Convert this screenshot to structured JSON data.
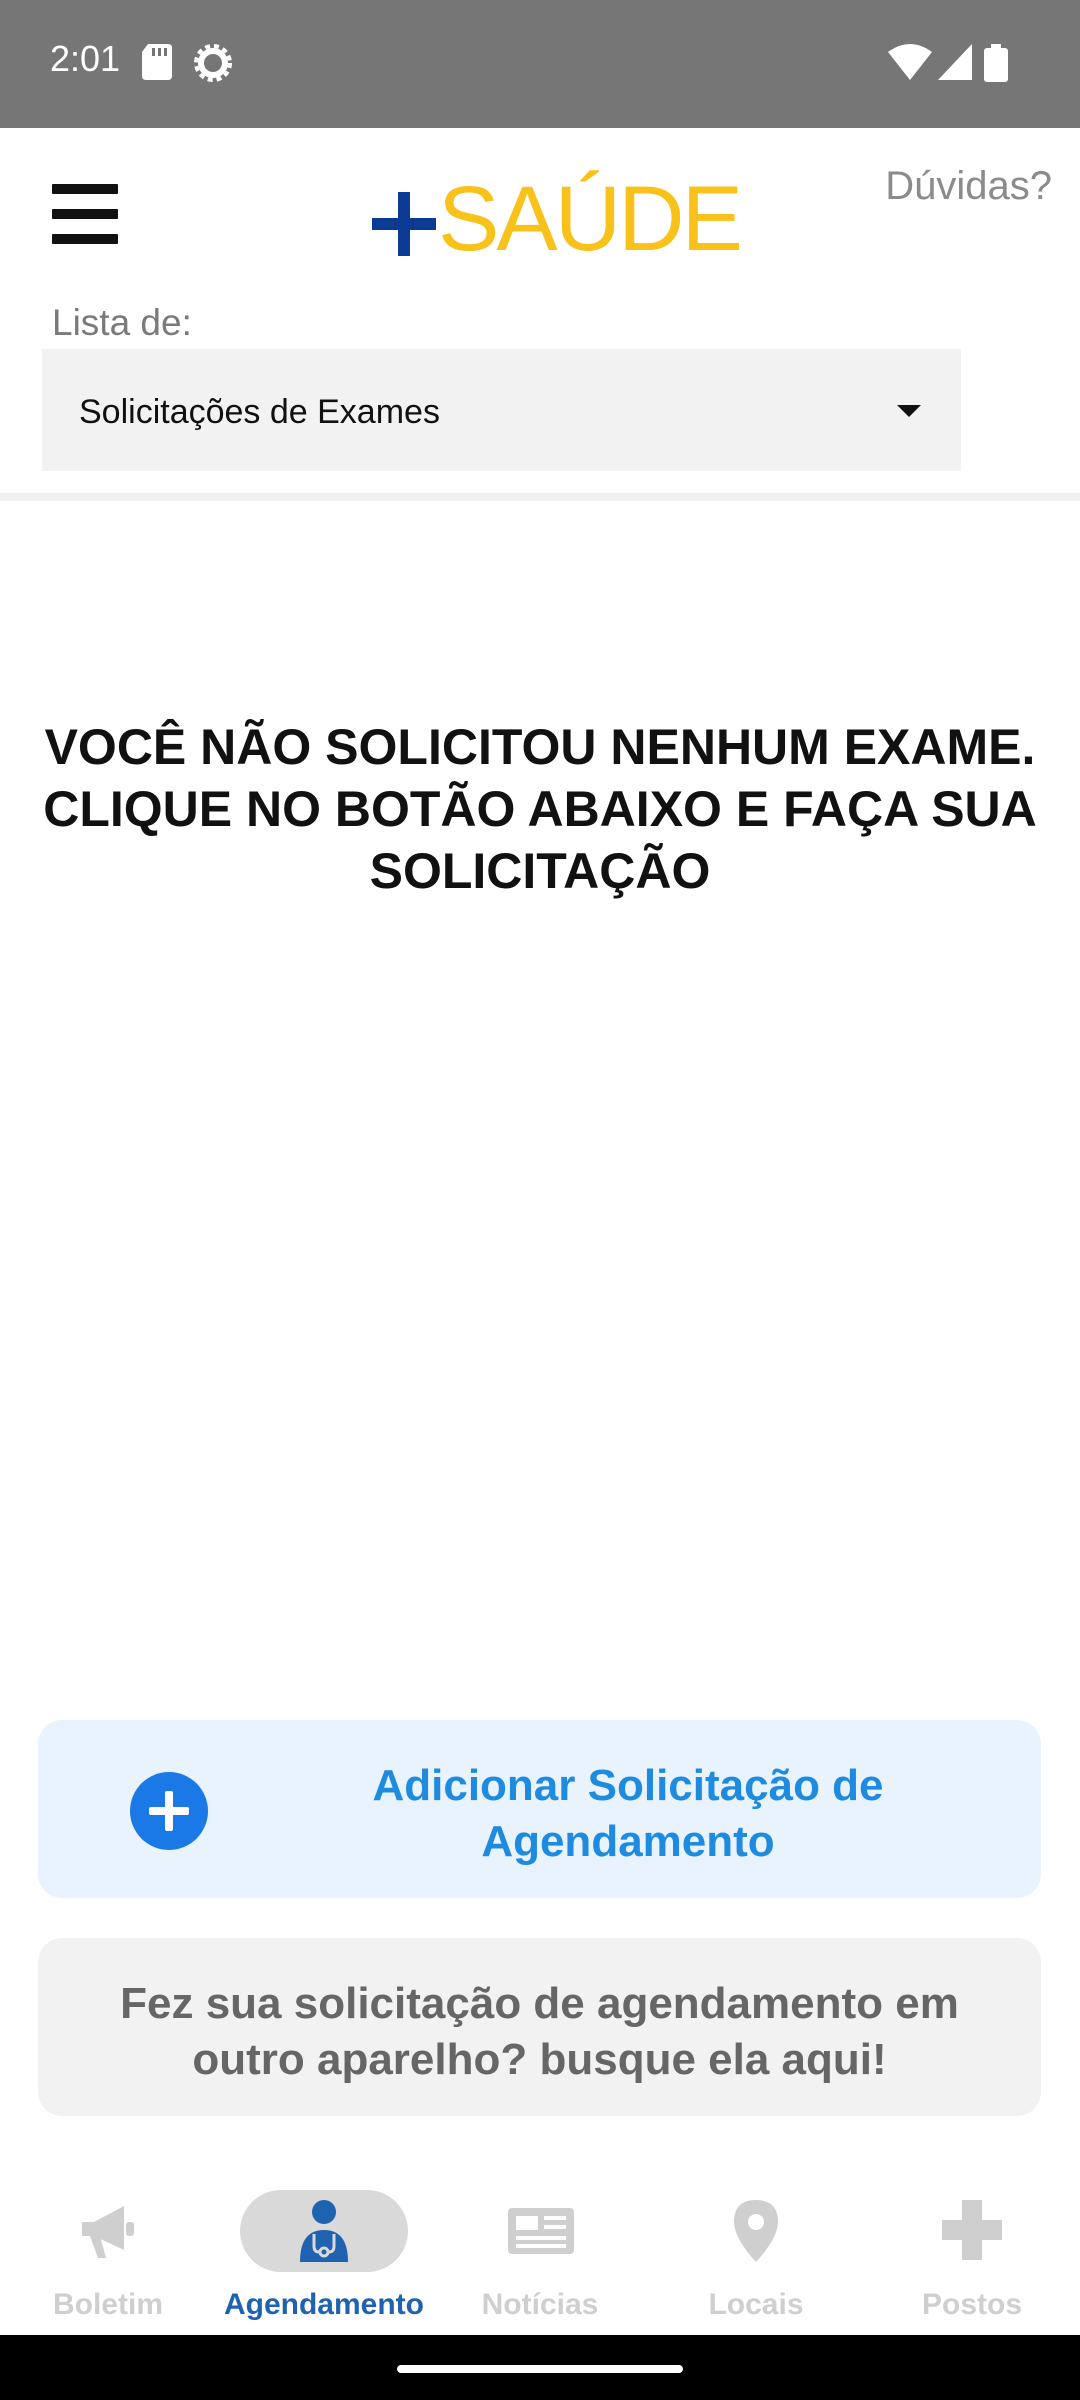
{
  "status_bar": {
    "time": "2:01",
    "icons": [
      "sd-card-icon",
      "settings-icon",
      "wifi-icon",
      "signal-icon",
      "battery-icon"
    ]
  },
  "header": {
    "logo_text": "SAÚDE",
    "help_label": "Dúvidas?"
  },
  "filter": {
    "label": "Lista de:",
    "selected": "Solicitações de Exames"
  },
  "empty_state": {
    "message": "VOCÊ NÃO SOLICITOU NENHUM EXAME. CLIQUE NO BOTÃO ABAIXO E FAÇA SUA SOLICITAÇÃO"
  },
  "actions": {
    "add_label": "Adicionar Solicitação de Agendamento",
    "search_label": "Fez sua solicitação de agendamento em outro aparelho? busque ela aqui!"
  },
  "bottom_nav": {
    "items": [
      {
        "label": "Boletim",
        "icon": "megaphone-icon",
        "active": false
      },
      {
        "label": "Agendamento",
        "icon": "doctor-icon",
        "active": true
      },
      {
        "label": "Notícias",
        "icon": "newspaper-icon",
        "active": false
      },
      {
        "label": "Locais",
        "icon": "location-pin-icon",
        "active": false
      },
      {
        "label": "Postos",
        "icon": "health-cross-icon",
        "active": false
      }
    ]
  },
  "colors": {
    "status_bar": "#767676",
    "logo_plus": "#0b3b93",
    "logo_text": "#f8c21a",
    "accent_blue": "#1a79e6",
    "active_nav": "#1f63b0",
    "inactive_nav": "#cfcfcf"
  }
}
